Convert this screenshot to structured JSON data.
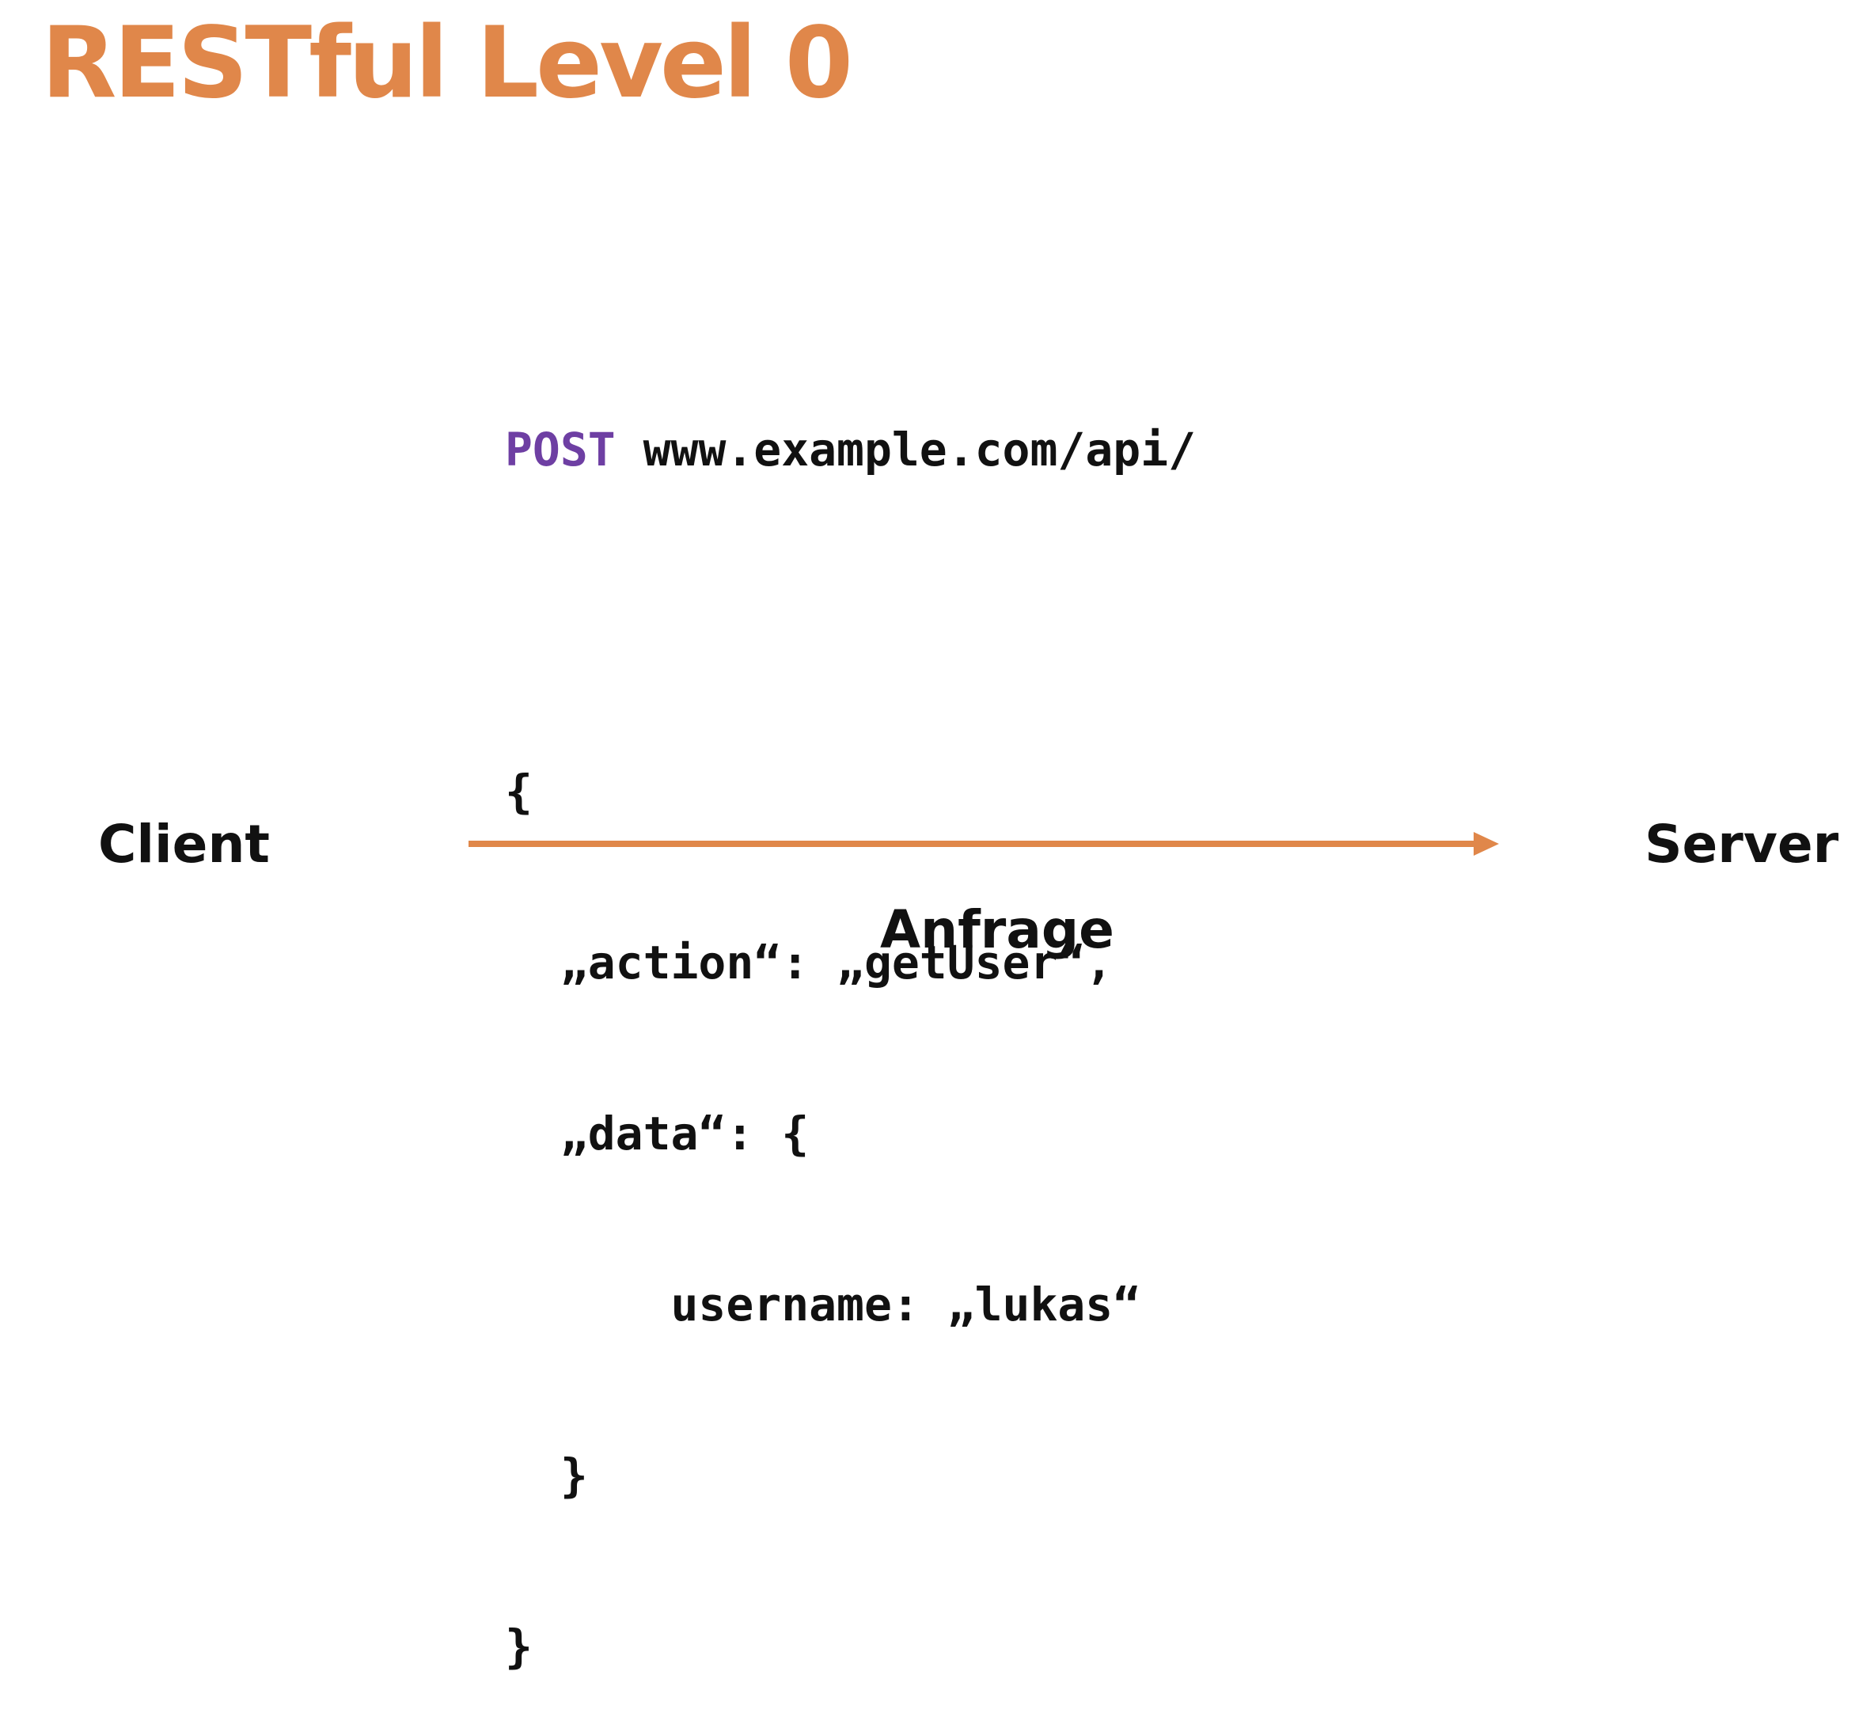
{
  "title": "RESTful Level 0",
  "request": {
    "method": "POST",
    "url": "www.example.com/api/",
    "body_lines": [
      "{",
      "  „action“: „getUser“,",
      "  „data“: {",
      "      username: „lukas“",
      "  }",
      "}"
    ]
  },
  "diagram": {
    "left_label": "Client",
    "right_label": "Server",
    "arrow_label": "Anfrage",
    "arrow_color": "#E0874A",
    "title_color": "#E0874A",
    "method_color": "#6E3FA3"
  }
}
